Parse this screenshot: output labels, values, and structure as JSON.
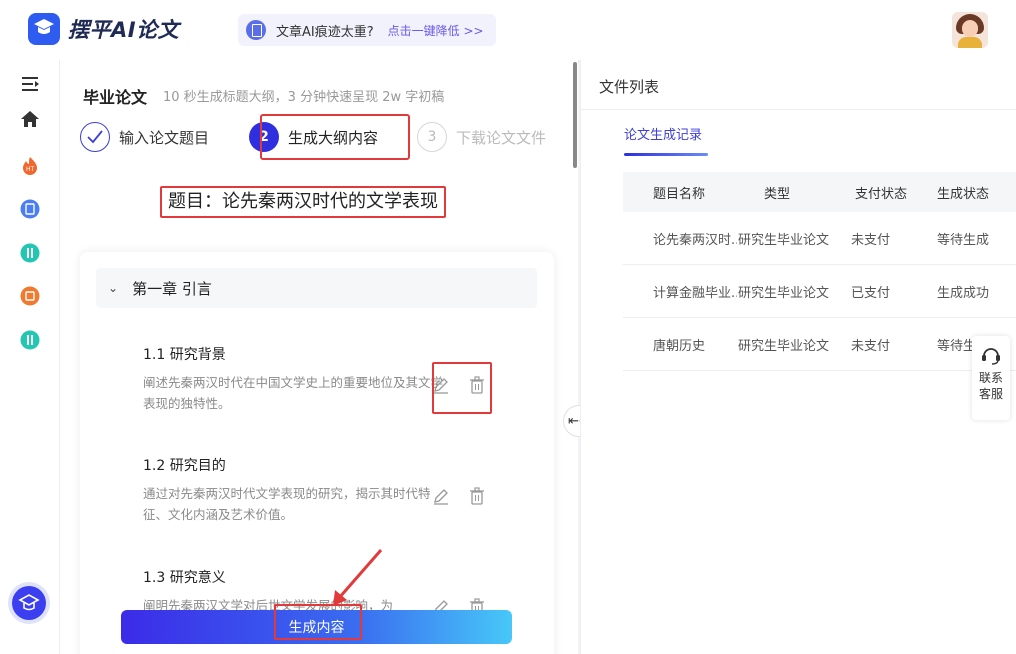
{
  "app": {
    "name": "摆平AI论文"
  },
  "promo": {
    "text": "文章AI痕迹太重?",
    "link": "点击一键降低 >>"
  },
  "page": {
    "title": "毕业论文",
    "subtitle": "10 秒生成标题大纲，3 分钟快速呈现 2w 字初稿"
  },
  "steps": [
    {
      "number": "",
      "label": "输入论文题目",
      "state": "done"
    },
    {
      "number": "2",
      "label": "生成大纲内容",
      "state": "active"
    },
    {
      "number": "3",
      "label": "下载论文文件",
      "state": "todo"
    }
  ],
  "topic": "题目：论先秦两汉时代的文学表现",
  "outline": {
    "chapter": "第一章 引言",
    "sections": [
      {
        "title": "1.1 研究背景",
        "desc": "阐述先秦两汉时代在中国文学史上的重要地位及其文学表现的独特性。"
      },
      {
        "title": "1.2 研究目的",
        "desc": "通过对先秦两汉时代文学表现的研究，揭示其时代特征、文化内涵及艺术价值。"
      },
      {
        "title": "1.3 研究意义",
        "desc": "阐明先秦两汉文学对后世文学发展的影响，为"
      }
    ]
  },
  "generate_button": "生成内容",
  "right": {
    "title": "文件列表",
    "tab": "论文生成记录",
    "columns": [
      "题目名称",
      "类型",
      "支付状态",
      "生成状态"
    ],
    "rows": [
      [
        "论先秦两汉时...",
        "研究生毕业论文",
        "未支付",
        "等待生成"
      ],
      [
        "计算金融毕业...",
        "研究生毕业论文",
        "已支付",
        "生成成功"
      ],
      [
        "唐朝历史",
        "研究生毕业论文",
        "未支付",
        "等待生成"
      ]
    ]
  },
  "support": {
    "label": "联系客服"
  },
  "colors": {
    "accent": "#2f2fe0",
    "highlight": "#e23a3a"
  }
}
